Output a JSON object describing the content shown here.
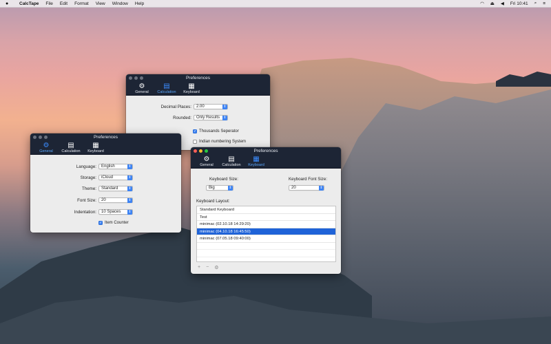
{
  "menubar": {
    "apple": "",
    "app": "CalcTape",
    "items": [
      "File",
      "Edit",
      "Format",
      "View",
      "Window",
      "Help"
    ],
    "clock": "Fri 10:41"
  },
  "toolbar_tabs": {
    "general": "General",
    "calculation": "Calculation",
    "keyboard": "Keyboard"
  },
  "window_title": "Preferences",
  "calc_window": {
    "decimal_places_label": "Decimal Places:",
    "decimal_places_value": "2.00",
    "rounded_label": "Rounded:",
    "rounded_value": "Only Results",
    "thousands_label": "Thousands Seperator",
    "thousands_checked": true,
    "indian_label": "Indian numbering System",
    "indian_checked": false
  },
  "general_window": {
    "language_label": "Language:",
    "language_value": "English",
    "storage_label": "Storage:",
    "storage_value": "iCloud",
    "theme_label": "Theme:",
    "theme_value": "Standard",
    "fontsize_label": "Font Size:",
    "fontsize_value": "20",
    "indentation_label": "Indentation:",
    "indentation_value": "10 Spaces",
    "item_counter_label": "Item Counter",
    "item_counter_checked": true
  },
  "keyboard_window": {
    "kb_size_label": "Keyboard Size:",
    "kb_size_value": "Big",
    "kb_font_label": "Keyboard Font Size:",
    "kb_font_value": "20",
    "layout_label": "Keyboard Layout:",
    "layouts": [
      "Standard Keyboard",
      "Test",
      "minimac (02.10.18 14:29:20)",
      "minimac (04.10.18 16:45:50)",
      "minimac (07.05.18 09:40:00)"
    ],
    "selected_index": 3,
    "add_label": "+",
    "remove_label": "−",
    "gear_label": "⚙"
  }
}
